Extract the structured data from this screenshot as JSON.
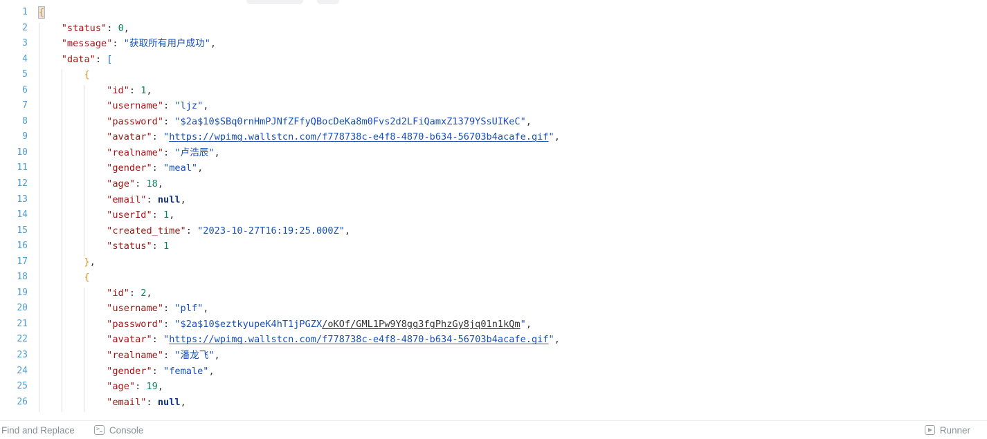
{
  "window": {
    "top_chrome_pills": 2
  },
  "editor": {
    "language": "json",
    "first_line": 1,
    "last_visible_line": 26,
    "matching_bracket_line": 1,
    "lines": [
      {
        "n": "1",
        "indent": 0,
        "tokens": [
          {
            "t": "brace-match-open",
            "v": "{"
          }
        ]
      },
      {
        "n": "2",
        "indent": 1,
        "tokens": [
          {
            "t": "key",
            "v": "\"status\""
          },
          {
            "t": "punct",
            "v": ": "
          },
          {
            "t": "num",
            "v": "0"
          },
          {
            "t": "punct",
            "v": ","
          }
        ]
      },
      {
        "n": "3",
        "indent": 1,
        "tokens": [
          {
            "t": "key",
            "v": "\"message\""
          },
          {
            "t": "punct",
            "v": ": "
          },
          {
            "t": "str",
            "v": "\"获取所有用户成功\""
          },
          {
            "t": "punct",
            "v": ","
          }
        ]
      },
      {
        "n": "4",
        "indent": 1,
        "tokens": [
          {
            "t": "key",
            "v": "\"data\""
          },
          {
            "t": "punct",
            "v": ": "
          },
          {
            "t": "bracket",
            "v": "["
          }
        ]
      },
      {
        "n": "5",
        "indent": 2,
        "tokens": [
          {
            "t": "brace",
            "v": "{"
          }
        ]
      },
      {
        "n": "6",
        "indent": 3,
        "tokens": [
          {
            "t": "key",
            "v": "\"id\""
          },
          {
            "t": "punct",
            "v": ": "
          },
          {
            "t": "num",
            "v": "1"
          },
          {
            "t": "punct",
            "v": ","
          }
        ]
      },
      {
        "n": "7",
        "indent": 3,
        "tokens": [
          {
            "t": "key",
            "v": "\"username\""
          },
          {
            "t": "punct",
            "v": ": "
          },
          {
            "t": "str",
            "v": "\"ljz\""
          },
          {
            "t": "punct",
            "v": ","
          }
        ]
      },
      {
        "n": "8",
        "indent": 3,
        "tokens": [
          {
            "t": "key",
            "v": "\"password\""
          },
          {
            "t": "punct",
            "v": ": "
          },
          {
            "t": "str",
            "v": "\"$2a$10$SBq0rnHmPJNfZFfyQBocDeKa8m0Fvs2d2LFiQamxZ1379YSsUIKeC\""
          },
          {
            "t": "punct",
            "v": ","
          }
        ]
      },
      {
        "n": "9",
        "indent": 3,
        "tokens": [
          {
            "t": "key",
            "v": "\"avatar\""
          },
          {
            "t": "punct",
            "v": ": "
          },
          {
            "t": "str",
            "v": "\""
          },
          {
            "t": "link",
            "v": "https://wpimg.wallstcn.com/f778738c-e4f8-4870-b634-56703b4acafe.gif"
          },
          {
            "t": "str",
            "v": "\""
          },
          {
            "t": "punct",
            "v": ","
          }
        ]
      },
      {
        "n": "10",
        "indent": 3,
        "tokens": [
          {
            "t": "key",
            "v": "\"realname\""
          },
          {
            "t": "punct",
            "v": ": "
          },
          {
            "t": "str",
            "v": "\"卢浩辰\""
          },
          {
            "t": "punct",
            "v": ","
          }
        ]
      },
      {
        "n": "11",
        "indent": 3,
        "tokens": [
          {
            "t": "key",
            "v": "\"gender\""
          },
          {
            "t": "punct",
            "v": ": "
          },
          {
            "t": "str",
            "v": "\"meal\""
          },
          {
            "t": "punct",
            "v": ","
          }
        ]
      },
      {
        "n": "12",
        "indent": 3,
        "tokens": [
          {
            "t": "key",
            "v": "\"age\""
          },
          {
            "t": "punct",
            "v": ": "
          },
          {
            "t": "num",
            "v": "18"
          },
          {
            "t": "punct",
            "v": ","
          }
        ]
      },
      {
        "n": "13",
        "indent": 3,
        "tokens": [
          {
            "t": "key",
            "v": "\"email\""
          },
          {
            "t": "punct",
            "v": ": "
          },
          {
            "t": "null",
            "v": "null"
          },
          {
            "t": "punct",
            "v": ","
          }
        ]
      },
      {
        "n": "14",
        "indent": 3,
        "tokens": [
          {
            "t": "key",
            "v": "\"userId\""
          },
          {
            "t": "punct",
            "v": ": "
          },
          {
            "t": "num",
            "v": "1"
          },
          {
            "t": "punct",
            "v": ","
          }
        ]
      },
      {
        "n": "15",
        "indent": 3,
        "tokens": [
          {
            "t": "key",
            "v": "\"created_time\""
          },
          {
            "t": "punct",
            "v": ": "
          },
          {
            "t": "str",
            "v": "\"2023-10-27T16:19:25.000Z\""
          },
          {
            "t": "punct",
            "v": ","
          }
        ]
      },
      {
        "n": "16",
        "indent": 3,
        "tokens": [
          {
            "t": "key",
            "v": "\"status\""
          },
          {
            "t": "punct",
            "v": ": "
          },
          {
            "t": "num",
            "v": "1"
          }
        ]
      },
      {
        "n": "17",
        "indent": 2,
        "tokens": [
          {
            "t": "brace",
            "v": "}"
          },
          {
            "t": "punct",
            "v": ","
          }
        ]
      },
      {
        "n": "18",
        "indent": 2,
        "tokens": [
          {
            "t": "brace",
            "v": "{"
          }
        ]
      },
      {
        "n": "19",
        "indent": 3,
        "tokens": [
          {
            "t": "key",
            "v": "\"id\""
          },
          {
            "t": "punct",
            "v": ": "
          },
          {
            "t": "num",
            "v": "2"
          },
          {
            "t": "punct",
            "v": ","
          }
        ]
      },
      {
        "n": "20",
        "indent": 3,
        "tokens": [
          {
            "t": "key",
            "v": "\"username\""
          },
          {
            "t": "punct",
            "v": ": "
          },
          {
            "t": "str",
            "v": "\"plf\""
          },
          {
            "t": "punct",
            "v": ","
          }
        ]
      },
      {
        "n": "21",
        "indent": 3,
        "tokens": [
          {
            "t": "key",
            "v": "\"password\""
          },
          {
            "t": "punct",
            "v": ": "
          },
          {
            "t": "str",
            "v": "\"$2a$10$eztkyupeK4hT1jPGZX"
          },
          {
            "t": "sub",
            "v": "/oKOf/GML1Pw9Y8gg3fgPhzGy8jq01n1kQm"
          },
          {
            "t": "str",
            "v": "\""
          },
          {
            "t": "punct",
            "v": ","
          }
        ]
      },
      {
        "n": "22",
        "indent": 3,
        "tokens": [
          {
            "t": "key",
            "v": "\"avatar\""
          },
          {
            "t": "punct",
            "v": ": "
          },
          {
            "t": "str",
            "v": "\""
          },
          {
            "t": "link",
            "v": "https://wpimg.wallstcn.com/f778738c-e4f8-4870-b634-56703b4acafe.gif"
          },
          {
            "t": "str",
            "v": "\""
          },
          {
            "t": "punct",
            "v": ","
          }
        ]
      },
      {
        "n": "23",
        "indent": 3,
        "tokens": [
          {
            "t": "key",
            "v": "\"realname\""
          },
          {
            "t": "punct",
            "v": ": "
          },
          {
            "t": "str",
            "v": "\"潘龙飞\""
          },
          {
            "t": "punct",
            "v": ","
          }
        ]
      },
      {
        "n": "24",
        "indent": 3,
        "tokens": [
          {
            "t": "key",
            "v": "\"gender\""
          },
          {
            "t": "punct",
            "v": ": "
          },
          {
            "t": "str",
            "v": "\"female\""
          },
          {
            "t": "punct",
            "v": ","
          }
        ]
      },
      {
        "n": "25",
        "indent": 3,
        "tokens": [
          {
            "t": "key",
            "v": "\"age\""
          },
          {
            "t": "punct",
            "v": ": "
          },
          {
            "t": "num",
            "v": "19"
          },
          {
            "t": "punct",
            "v": ","
          }
        ]
      },
      {
        "n": "26",
        "indent": 3,
        "tokens": [
          {
            "t": "key",
            "v": "\"email\""
          },
          {
            "t": "punct",
            "v": ": "
          },
          {
            "t": "null",
            "v": "null"
          },
          {
            "t": "punct",
            "v": ","
          }
        ]
      }
    ]
  },
  "statusbar": {
    "find_and_replace_label": "Find and Replace",
    "console_label": "Console",
    "console_icon": "terminal-icon",
    "runner_label": "Runner",
    "runner_icon": "play-icon"
  },
  "colors": {
    "key": "#a31515",
    "string": "#1750b5",
    "number": "#098658",
    "null": "#0d2f8f",
    "brace": "#e2931d",
    "bracket": "#1b6fd4",
    "line_number": "#4e9dd4",
    "indent_guide": "#dcdcdc",
    "status_text": "#8a8f98",
    "background": "#ffffff"
  }
}
